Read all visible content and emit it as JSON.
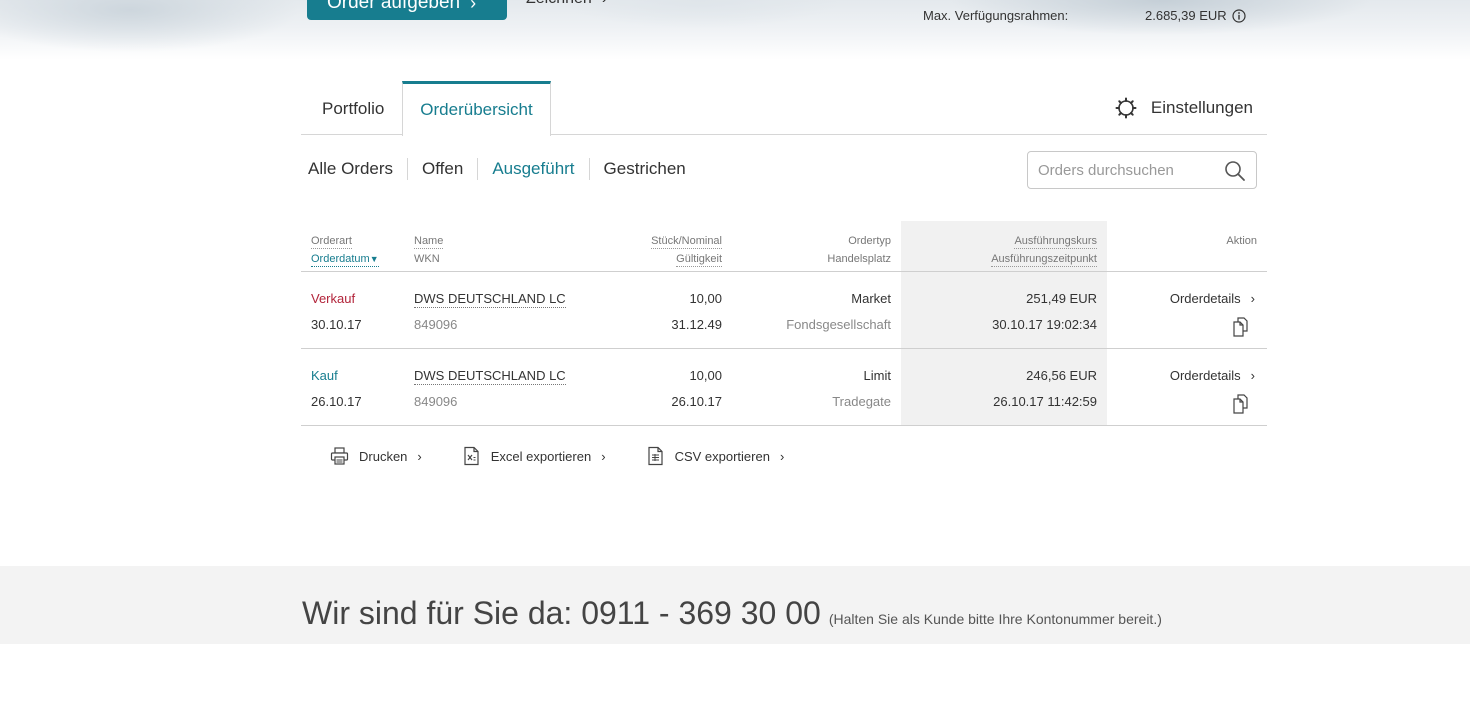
{
  "header": {
    "order_button_label": "Order aufgeben",
    "zeichnen_label": "Zeichnen",
    "limit_label": "Max. Verfügungsrahmen:",
    "limit_value": "2.685,39 EUR"
  },
  "tabs": {
    "portfolio": "Portfolio",
    "orderuebersicht": "Orderübersicht",
    "settings": "Einstellungen"
  },
  "filters": [
    "Alle Orders",
    "Offen",
    "Ausgeführt",
    "Gestrichen"
  ],
  "active_filter": "Ausgeführt",
  "search": {
    "placeholder": "Orders durchsuchen"
  },
  "table": {
    "headers": {
      "orderart": "Orderart",
      "orderdatum": "Orderdatum",
      "name": "Name",
      "wkn": "WKN",
      "stueck": "Stück/Nominal",
      "gueltigkeit": "Gültigkeit",
      "ordertyp": "Ordertyp",
      "handelsplatz": "Handelsplatz",
      "kurs": "Ausführungskurs",
      "zeitpunkt": "Ausführungszeitpunkt",
      "aktion": "Aktion"
    },
    "rows": [
      {
        "orderart": "Verkauf",
        "orderdatum": "30.10.17",
        "name": "DWS DEUTSCHLAND LC",
        "wkn": "849096",
        "stueck": "10,00",
        "gueltigkeit": "31.12.49",
        "ordertyp": "Market",
        "handelsplatz": "Fondsgesellschaft",
        "kurs": "251,49 EUR",
        "zeitpunkt": "30.10.17 19:02:34",
        "aktion": "Orderdetails"
      },
      {
        "orderart": "Kauf",
        "orderdatum": "26.10.17",
        "name": "DWS DEUTSCHLAND LC",
        "wkn": "849096",
        "stueck": "10,00",
        "gueltigkeit": "26.10.17",
        "ordertyp": "Limit",
        "handelsplatz": "Tradegate",
        "kurs": "246,56 EUR",
        "zeitpunkt": "26.10.17 11:42:59",
        "aktion": "Orderdetails"
      }
    ]
  },
  "exports": {
    "print": "Drucken",
    "excel": "Excel exportieren",
    "csv": "CSV exportieren"
  },
  "footer": {
    "main": "Wir sind für Sie da: 0911 - 369 30 00",
    "note": "(Halten Sie als Kunde bitte Ihre Kontonummer bereit.)"
  },
  "colors": {
    "accent": "#177d8f",
    "sell": "#b2243a",
    "buy": "#177d8f"
  },
  "icons": [
    "chevron-right-icon",
    "info-icon",
    "gear-icon",
    "search-icon",
    "copy-icon",
    "printer-icon",
    "excel-icon",
    "csv-icon"
  ]
}
